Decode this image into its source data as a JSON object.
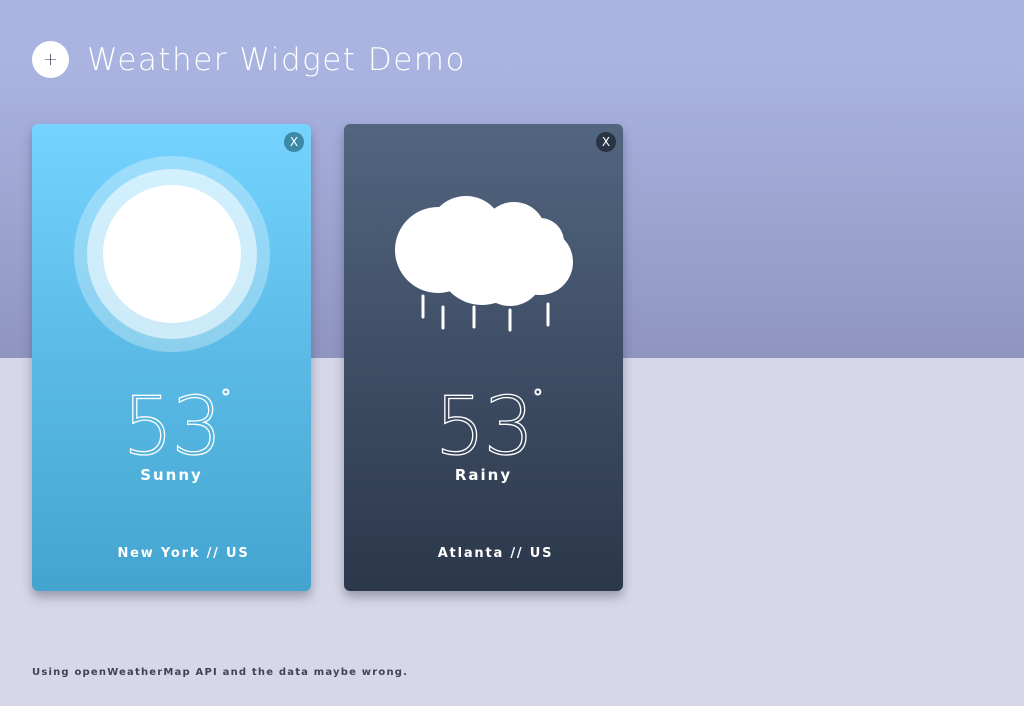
{
  "header": {
    "add_label": "+",
    "title": "Weather Widget Demo"
  },
  "cards": [
    {
      "temperature": "53",
      "degree_symbol": "°",
      "condition": "Sunny",
      "location": "New York // US",
      "close_label": "X",
      "icon": "sun-icon",
      "colors": {
        "top": "#76d3ff",
        "bottom": "#43a5cf"
      }
    },
    {
      "temperature": "53",
      "degree_symbol": "°",
      "condition": "Rainy",
      "location": "Atlanta // US",
      "close_label": "X",
      "icon": "rain-cloud-icon",
      "colors": {
        "top": "#52657f",
        "bottom": "#2b374a"
      }
    }
  ],
  "footer": {
    "note": "Using openWeatherMap API and the data maybe wrong."
  },
  "colors": {
    "background_top": "#aab4e1",
    "background_bottom": "#d6d8e9"
  }
}
